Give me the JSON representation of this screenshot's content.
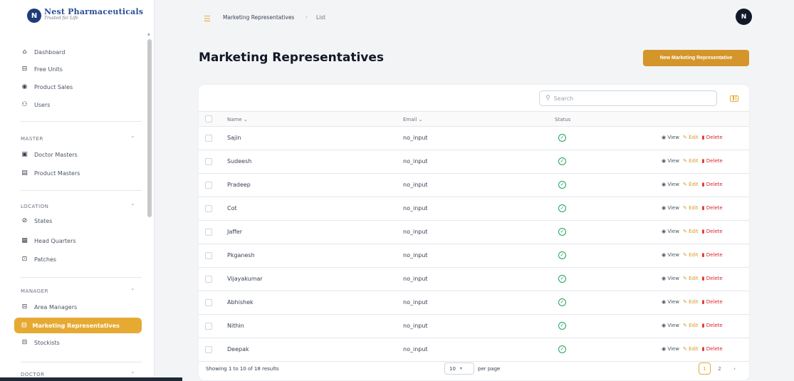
{
  "brand": {
    "logo_letter": "N",
    "name": "Nest Pharmaceuticals",
    "tagline": "Trusted for Life"
  },
  "sidebar": {
    "top_items": [
      {
        "label": "Dashboard",
        "icon": "home-icon"
      },
      {
        "label": "Free Units",
        "icon": "box-icon"
      },
      {
        "label": "Product Sales",
        "icon": "chart-icon"
      },
      {
        "label": "Users",
        "icon": "users-icon"
      }
    ],
    "sections": [
      {
        "title": "MASTER",
        "items": [
          {
            "label": "Doctor Masters",
            "icon": "clipboard-icon"
          },
          {
            "label": "Product Masters",
            "icon": "table-icon"
          }
        ]
      },
      {
        "title": "LOCATION",
        "items": [
          {
            "label": "States",
            "icon": "globe-icon"
          },
          {
            "label": "Head Quarters",
            "icon": "building-icon"
          },
          {
            "label": "Patches",
            "icon": "briefcase-icon"
          }
        ]
      },
      {
        "title": "MANAGER",
        "items": [
          {
            "label": "Area Managers",
            "icon": "box-icon"
          },
          {
            "label": "Marketing Representatives",
            "icon": "box-icon",
            "active": true
          },
          {
            "label": "Stockists",
            "icon": "box-icon"
          }
        ]
      },
      {
        "title": "DOCTOR",
        "items": []
      }
    ]
  },
  "header": {
    "breadcrumb": [
      "Marketing Representatives",
      "List"
    ],
    "avatar_initial": "N"
  },
  "page": {
    "title": "Marketing Representatives",
    "new_button": "New Marketing Representative"
  },
  "table": {
    "search_placeholder": "Search",
    "columns": {
      "name": "Name",
      "email": "Email",
      "status": "Status"
    },
    "rows": [
      {
        "name": "Sajin",
        "email": "no_input"
      },
      {
        "name": "Sudeesh",
        "email": "no_input"
      },
      {
        "name": "Pradeep",
        "email": "no_input"
      },
      {
        "name": "Cot",
        "email": "no_input"
      },
      {
        "name": "Jaffer",
        "email": "no_input"
      },
      {
        "name": "Pkganesh",
        "email": "no_input"
      },
      {
        "name": "Vijayakumar",
        "email": "no_input"
      },
      {
        "name": "Abhishek",
        "email": "no_input"
      },
      {
        "name": "Nithin",
        "email": "no_input"
      },
      {
        "name": "Deepak",
        "email": "no_input"
      }
    ],
    "actions": {
      "view": "View",
      "edit": "Edit",
      "delete": "Delete"
    },
    "footer": {
      "summary": "Showing 1 to 10 of 18 results",
      "per_page_value": "10",
      "per_page_label": "per page",
      "pages": [
        "1",
        "2"
      ],
      "current_page": "1"
    }
  },
  "colors": {
    "accent": "#e6aa33",
    "status_active": "#22a35a",
    "delete": "#dc2626",
    "brand_blue": "#1d3c78"
  }
}
